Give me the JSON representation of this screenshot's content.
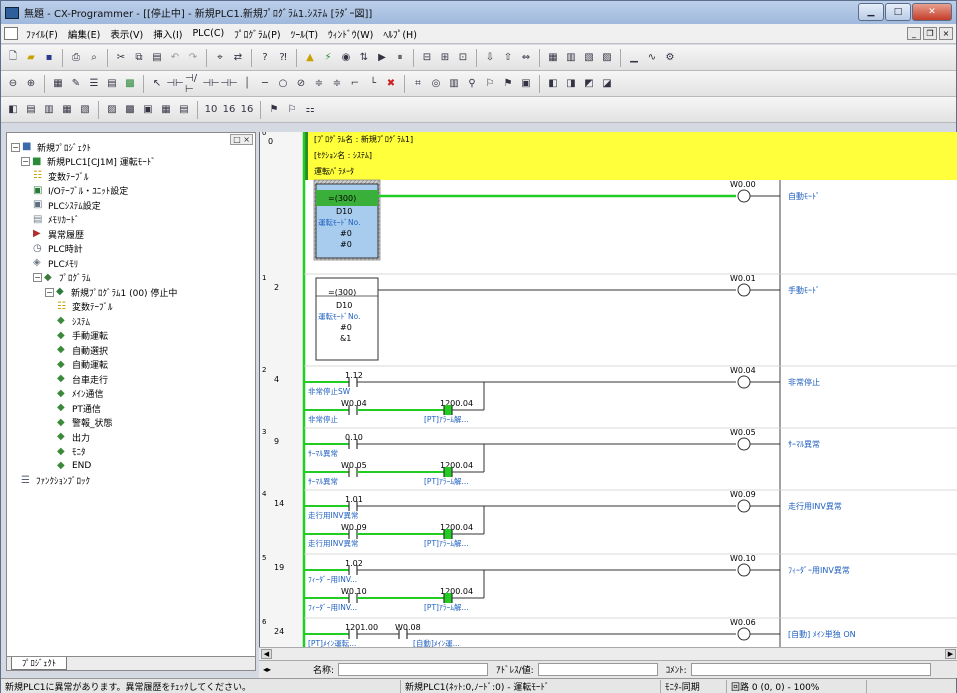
{
  "titlebar": {
    "title": "無題 - CX-Programmer - [[停止中] - 新規PLC1.新規ﾌﾟﾛｸﾞﾗﾑ1.ｼｽﾃﾑ [ﾗﾀﾞｰ図]]"
  },
  "menubar": {
    "items": [
      "ﾌｧｲﾙ(F)",
      "編集(E)",
      "表示(V)",
      "挿入(I)",
      "PLC(C)",
      "ﾌﾟﾛｸﾞﾗﾑ(P)",
      "ﾂｰﾙ(T)",
      "ｳｨﾝﾄﾞｳ(W)",
      "ﾍﾙﾌﾟ(H)"
    ]
  },
  "project_tree": {
    "tab_label": "ﾌﾟﾛｼﾞｪｸﾄ",
    "nodes": [
      {
        "label": "新規ﾌﾟﾛｼﾞｪｸﾄ",
        "level": 0,
        "expander": "−",
        "icon": "project-icon",
        "color": "#3a6aa8"
      },
      {
        "label": "新規PLC1[CJ1M] 運転ﾓｰﾄﾞ",
        "level": 1,
        "expander": "−",
        "icon": "plc-icon",
        "color": "#2a8a3a"
      },
      {
        "label": "変数ﾃｰﾌﾞﾙ",
        "level": 2,
        "expander": "",
        "icon": "symbol-table-icon",
        "color": "#c9a000"
      },
      {
        "label": "I/Oﾃｰﾌﾞﾙ・ﾕﾆｯﾄ設定",
        "level": 2,
        "expander": "",
        "icon": "io-table-icon",
        "color": "#2a7a3a"
      },
      {
        "label": "PLCｼｽﾃﾑ設定",
        "level": 2,
        "expander": "",
        "icon": "settings-icon",
        "color": "#607080"
      },
      {
        "label": "ﾒﾓﾘｶｰﾄﾞ",
        "level": 2,
        "expander": "",
        "icon": "memory-card-icon",
        "color": "#708090"
      },
      {
        "label": "異常履歴",
        "level": 2,
        "expander": "",
        "icon": "error-log-icon",
        "color": "#b03030"
      },
      {
        "label": "PLC時計",
        "level": 2,
        "expander": "",
        "icon": "clock-icon",
        "color": "#556070"
      },
      {
        "label": "PLCﾒﾓﾘ",
        "level": 2,
        "expander": "",
        "icon": "memory-icon",
        "color": "#6a7888"
      },
      {
        "label": "ﾌﾟﾛｸﾞﾗﾑ",
        "level": 2,
        "expander": "−",
        "icon": "programs-icon",
        "color": "#3a7a3a"
      },
      {
        "label": "新規ﾌﾟﾛｸﾞﾗﾑ1 (00) 停止中",
        "level": 3,
        "expander": "−",
        "icon": "program-icon",
        "color": "#2a7a3a"
      },
      {
        "label": "変数ﾃｰﾌﾞﾙ",
        "level": 4,
        "expander": "",
        "icon": "symbol-table-icon",
        "color": "#c9a000"
      },
      {
        "label": "ｼｽﾃﾑ",
        "level": 4,
        "expander": "",
        "icon": "section-icon",
        "color": "#3a8a3a"
      },
      {
        "label": "手動運転",
        "level": 4,
        "expander": "",
        "icon": "section-icon",
        "color": "#3a8a3a"
      },
      {
        "label": "自動選択",
        "level": 4,
        "expander": "",
        "icon": "section-icon",
        "color": "#3a8a3a"
      },
      {
        "label": "自動運転",
        "level": 4,
        "expander": "",
        "icon": "section-icon",
        "color": "#3a8a3a"
      },
      {
        "label": "台車走行",
        "level": 4,
        "expander": "",
        "icon": "section-icon",
        "color": "#3a8a3a"
      },
      {
        "label": "ﾒｲﾝ通信",
        "level": 4,
        "expander": "",
        "icon": "section-icon",
        "color": "#3a8a3a"
      },
      {
        "label": "PT通信",
        "level": 4,
        "expander": "",
        "icon": "section-icon",
        "color": "#3a8a3a"
      },
      {
        "label": "警報_状態",
        "level": 4,
        "expander": "",
        "icon": "section-icon",
        "color": "#3a8a3a"
      },
      {
        "label": "出力",
        "level": 4,
        "expander": "",
        "icon": "section-icon",
        "color": "#3a8a3a"
      },
      {
        "label": "ﾓﾆﾀ",
        "level": 4,
        "expander": "",
        "icon": "section-icon",
        "color": "#3a8a3a"
      },
      {
        "label": "END",
        "level": 4,
        "expander": "",
        "icon": "section-icon",
        "color": "#3a8a3a"
      },
      {
        "label": "ﾌｧﾝｸｼｮﾝﾌﾞﾛｯｸ",
        "level": 1,
        "expander": "",
        "icon": "function-block-icon",
        "color": "#556070"
      }
    ]
  },
  "ladder": {
    "header_lines": [
      "[ﾌﾟﾛｸﾞﾗﾑ名 : 新規ﾌﾟﾛｸﾞﾗﾑ1]",
      "[ｾｸｼｮﾝ名 : ｼｽﾃﾑ]",
      "運転ﾊﾟﾗﾒｰﾀ"
    ],
    "rungs": [
      {
        "number": "0",
        "step": "0",
        "box": [
          "=(300)",
          "D10",
          "運転ﾓｰﾄﾞNo.",
          "#0",
          "#0"
        ],
        "out_addr": "W0.00",
        "out_comment": "自動ﾓｰﾄﾞ"
      },
      {
        "number": "1",
        "step": "2",
        "box": [
          "=(300)",
          "D10",
          "運転ﾓｰﾄﾞNo.",
          "#0",
          "&1"
        ],
        "out_addr": "W0.01",
        "out_comment": "手動ﾓｰﾄﾞ"
      },
      {
        "number": "2",
        "step": "4",
        "contact_addr": "1.12",
        "contact_comment": "非常停止SW",
        "self_addr": "W0.04",
        "self_comment": "非常停止",
        "reset_addr": "1200.04",
        "reset_comment": "[PT]ｱﾗｰﾑ解...",
        "out_addr": "W0.04",
        "out_comment": "非常停止"
      },
      {
        "number": "3",
        "step": "9",
        "contact_addr": "0.10",
        "contact_comment": "ｻｰﾏﾙ異常",
        "self_addr": "W0.05",
        "self_comment": "ｻｰﾏﾙ異常",
        "reset_addr": "1200.04",
        "reset_comment": "[PT]ｱﾗｰﾑ解...",
        "out_addr": "W0.05",
        "out_comment": "ｻｰﾏﾙ異常"
      },
      {
        "number": "4",
        "step": "14",
        "contact_addr": "1.01",
        "contact_comment": "走行用INV異常",
        "self_addr": "W0.09",
        "self_comment": "走行用INV異常",
        "reset_addr": "1200.04",
        "reset_comment": "[PT]ｱﾗｰﾑ解...",
        "out_addr": "W0.09",
        "out_comment": "走行用INV異常"
      },
      {
        "number": "5",
        "step": "19",
        "contact_addr": "1.02",
        "contact_comment": "ﾌｨｰﾀﾞｰ用INV...",
        "self_addr": "W0.10",
        "self_comment": "ﾌｨｰﾀﾞｰ用INV...",
        "reset_addr": "1200.04",
        "reset_comment": "[PT]ｱﾗｰﾑ解...",
        "out_addr": "W0.10",
        "out_comment": "ﾌｨｰﾀﾞｰ用INV異常"
      },
      {
        "number": "6",
        "step": "24",
        "contact_addr": "1201.00",
        "contact2_addr": "W0.08",
        "contact_comment": "[PT]ﾒｲﾝ運転...",
        "contact2_comment": "[自動]ﾒｲﾝ運...",
        "out_addr": "W0.06",
        "out_comment": "[自動] ﾒｲﾝ単独 ON"
      }
    ]
  },
  "infobar": {
    "name_label": "名称:",
    "address_label": "ｱﾄﾞﾚｽ/値:",
    "comment_label": "ｺﾒﾝﾄ:"
  },
  "statusbar": {
    "message": "新規PLC1に異常があります。異常履歴をﾁｪｯｸしてください。",
    "plc": "新規PLC1(ﾈｯﾄ:0,ﾉｰﾄﾞ:0) - 運転ﾓｰﾄﾞ",
    "sync": "ﾓﾆﾀ-同期",
    "circuit": "回路 0 (0, 0)  - 100%"
  },
  "colors": {
    "highlight": "#ffff3c",
    "power": "#22cc22",
    "selected_box": "#a8ccee",
    "comment": "#2060c0"
  }
}
